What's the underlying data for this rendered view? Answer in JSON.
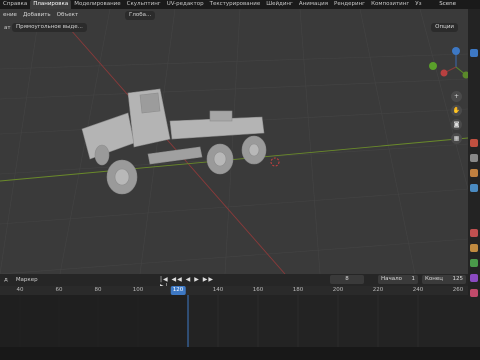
{
  "workspaces": [
    "Справка",
    "Планировка",
    "Моделирование",
    "Скульптинг",
    "UV-редактор",
    "Текстурирование",
    "Шейдинг",
    "Анимация",
    "Рендеринг",
    "Композитинг",
    "Уз"
  ],
  "active_workspace": "Планировка",
  "scene_name": "Scene",
  "viewport": {
    "menus": [
      "ение",
      "Добавить",
      "Объект"
    ],
    "transform_orientation": "Глоба...",
    "select_mode": "Прямоугольное выде...",
    "select_prefix": "ат",
    "options": "Опции"
  },
  "timeline": {
    "left_labels": [
      "д",
      "Маркер"
    ],
    "current_frame": "8",
    "start_label": "Начало",
    "start_value": "1",
    "end_label": "Конец",
    "end_value": "125",
    "ruler": [
      "40",
      "60",
      "80",
      "100",
      "120",
      "140",
      "160",
      "180",
      "200",
      "220",
      "240",
      "260"
    ],
    "ruler_current": "120"
  },
  "colors": {
    "accent": "#3d78c4",
    "x_axis": "#8a3a3a",
    "y_axis": "#6a8a2a"
  }
}
